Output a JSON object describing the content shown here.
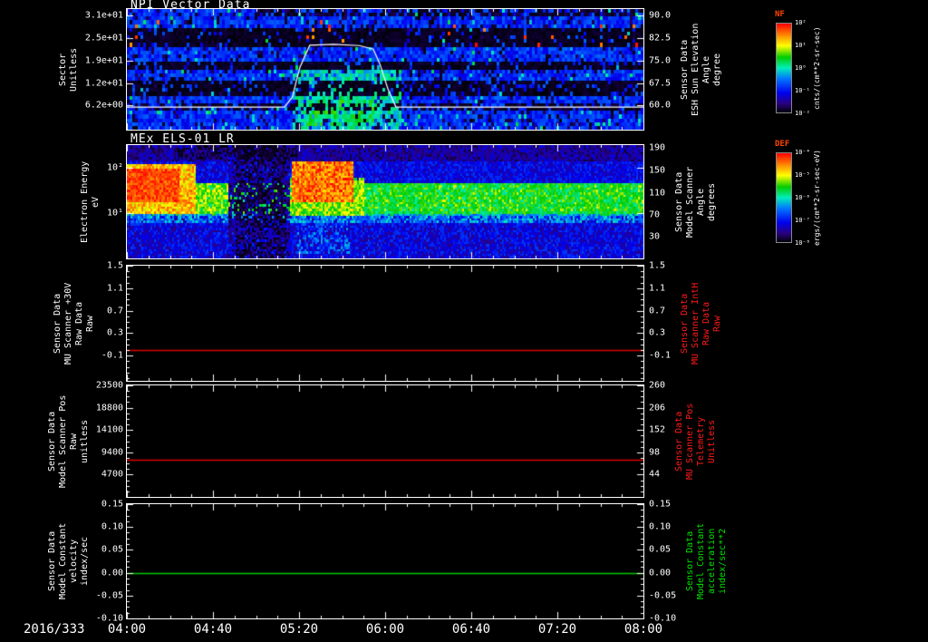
{
  "figure": {
    "background": "#000000",
    "foreground": "#ffffff"
  },
  "colormap": [
    [
      0,
      "#000008"
    ],
    [
      0.1,
      "#2a0080"
    ],
    [
      0.22,
      "#0000ee"
    ],
    [
      0.38,
      "#0077ff"
    ],
    [
      0.5,
      "#00eebb"
    ],
    [
      0.62,
      "#00cc00"
    ],
    [
      0.75,
      "#ffff00"
    ],
    [
      0.87,
      "#ff8800"
    ],
    [
      1,
      "#ff0000"
    ]
  ],
  "xaxis": {
    "date_label": "2016/333",
    "tick_labels": [
      "04:00",
      "04:40",
      "05:20",
      "06:00",
      "06:40",
      "07:20",
      "08:00"
    ]
  },
  "chart_data": [
    {
      "type": "heatmap",
      "title": "NPI Vector Data",
      "ylabel_lines": [
        "Sector",
        "Unitless"
      ],
      "left_ticks": [
        "3.1e+01",
        "2.5e+01",
        "1.9e+01",
        "1.2e+01",
        "6.2e+00"
      ],
      "left_tick_fracs": [
        0.05,
        0.24,
        0.43,
        0.62,
        0.8
      ],
      "right_ticks": [
        "90.0",
        "82.5",
        "75.0",
        "67.5",
        "60.0"
      ],
      "right_tick_fracs": [
        0.05,
        0.24,
        0.43,
        0.62,
        0.8
      ],
      "right_label_lines": [
        "Sensor Data",
        "ESH Sun Elevation",
        "Angle",
        "degree"
      ],
      "right_label_color": "#ffffff",
      "colorbar": {
        "label": "NF",
        "label_color": "#ff4500",
        "units": "cnts/(cm**2-sr-sec)",
        "ticks": [
          "10²",
          "10¹",
          "10⁰",
          "10⁻¹",
          "10⁻²"
        ]
      },
      "x_range": [
        "04:00",
        "08:00"
      ],
      "rows": 32,
      "cols": 190,
      "seed": 7,
      "features": [
        {
          "x": [
            0,
            1
          ],
          "y": [
            0,
            1
          ],
          "v": [
            0.2,
            0.36
          ]
        },
        {
          "x": [
            0.32,
            0.53
          ],
          "y": [
            0.48,
            1
          ],
          "v": [
            0.4,
            0.58
          ],
          "p": 0.85
        },
        {
          "x": [
            0.35,
            0.48
          ],
          "y": [
            0.7,
            0.97
          ],
          "v": [
            0.48,
            0.66
          ],
          "p": 0.6
        },
        {
          "x": [
            0,
            1
          ],
          "y": [
            0,
            1
          ],
          "v": [
            0.0,
            0.08
          ],
          "p": 0.12
        },
        {
          "x": [
            0,
            1
          ],
          "y": [
            0,
            1
          ],
          "v": [
            0.42,
            0.58
          ],
          "p": 0.04
        },
        {
          "x": [
            0,
            1
          ],
          "y": [
            0.16,
            0.3
          ],
          "v": [
            0.0,
            0.04
          ],
          "p": 0.86
        },
        {
          "x": [
            0,
            1
          ],
          "y": [
            0.44,
            0.5
          ],
          "v": [
            0.0,
            0.04
          ],
          "p": 0.82
        },
        {
          "x": [
            0,
            1
          ],
          "y": [
            0.58,
            0.72
          ],
          "v": [
            0.0,
            0.04
          ],
          "p": 0.76
        },
        {
          "x": [
            0,
            1
          ],
          "y": [
            0.79,
            0.83
          ],
          "v": [
            0.0,
            0.04
          ],
          "p": 0.5
        },
        {
          "x": [
            0.25,
            1
          ],
          "y": [
            0,
            0.05
          ],
          "v": [
            0.0,
            0.06
          ],
          "p": 0.55
        },
        {
          "x": [
            0,
            1
          ],
          "y": [
            0.1,
            0.3
          ],
          "v": [
            0.85,
            1.0
          ],
          "p": 0.02
        }
      ],
      "overlay_line": {
        "name": "sun-elevation-angle",
        "color": "#ffffff",
        "value_range": [
          52.3,
          92.3
        ],
        "points": [
          [
            0,
            59.8
          ],
          [
            0.305,
            59.8
          ],
          [
            0.32,
            63
          ],
          [
            0.335,
            73
          ],
          [
            0.354,
            80.3
          ],
          [
            0.4,
            80.6
          ],
          [
            0.45,
            80.2
          ],
          [
            0.477,
            79
          ],
          [
            0.49,
            74
          ],
          [
            0.505,
            66
          ],
          [
            0.521,
            59.8
          ],
          [
            1,
            59.8
          ]
        ]
      }
    },
    {
      "type": "heatmap",
      "title": "MEx ELS-01 LR",
      "ylabel_lines": [
        "Electron Energy",
        "eV"
      ],
      "left_ticks": [
        "10²",
        "10¹"
      ],
      "left_tick_fracs": [
        0.2,
        0.6
      ],
      "right_ticks": [
        "190",
        "150",
        "110",
        "70",
        "30"
      ],
      "right_tick_fracs": [
        0.025,
        0.22,
        0.42,
        0.615,
        0.81
      ],
      "right_label_lines": [
        "Sensor Data",
        "Model Scanner",
        "Angle",
        "degrees"
      ],
      "right_label_color": "#ffffff",
      "colorbar": {
        "label": "DEF",
        "label_color": "#ff4500",
        "units": "ergs/(cm**2-sr-sec-eV)",
        "ticks": [
          "10⁻⁴",
          "10⁻⁵",
          "10⁻⁶",
          "10⁻⁷",
          "10⁻⁸"
        ]
      },
      "x_range": [
        "04:00",
        "08:00"
      ],
      "rows": 48,
      "cols": 285,
      "seed": 13,
      "features": [
        {
          "x": [
            0,
            1
          ],
          "y": [
            0,
            1
          ],
          "v": [
            0.13,
            0.3
          ]
        },
        {
          "x": [
            0,
            1
          ],
          "y": [
            0.7,
            1
          ],
          "v": [
            0.1,
            0.3
          ],
          "p": 0.9
        },
        {
          "x": [
            0,
            1
          ],
          "y": [
            0,
            0.14
          ],
          "v": [
            0.04,
            0.22
          ]
        },
        {
          "x": [
            0,
            1
          ],
          "y": [
            0.34,
            0.62
          ],
          "v": [
            0.5,
            0.68
          ]
        },
        {
          "x": [
            0,
            1
          ],
          "y": [
            0.6,
            0.68
          ],
          "v": [
            0.3,
            0.5
          ],
          "p": 0.7
        },
        {
          "x": [
            0,
            0.135
          ],
          "y": [
            0.16,
            0.6
          ],
          "v": [
            0.7,
            0.92
          ]
        },
        {
          "x": [
            0,
            0.1
          ],
          "y": [
            0.2,
            0.5
          ],
          "v": [
            0.86,
            1.0
          ]
        },
        {
          "x": [
            0.135,
            0.2
          ],
          "y": [
            0.34,
            0.6
          ],
          "v": [
            0.58,
            0.78
          ],
          "p": 0.8
        },
        {
          "x": [
            0.195,
            0.315
          ],
          "y": [
            0,
            1
          ],
          "v": [
            0.02,
            0.22
          ],
          "p": 0.75
        },
        {
          "x": [
            0.21,
            0.31
          ],
          "y": [
            0,
            1
          ],
          "v": [
            0.0,
            0.04
          ],
          "p": 0.35
        },
        {
          "x": [
            0.315,
            0.46
          ],
          "y": [
            0.3,
            0.62
          ],
          "v": [
            0.58,
            0.8
          ],
          "p": 0.9
        },
        {
          "x": [
            0.32,
            0.44
          ],
          "y": [
            0.14,
            0.5
          ],
          "v": [
            0.78,
            1.0
          ]
        },
        {
          "x": [
            0.1,
            0.33
          ],
          "y": [
            0,
            0.12
          ],
          "v": [
            0.0,
            0.05
          ],
          "p": 0.5
        },
        {
          "x": [
            0.45,
            1
          ],
          "y": [
            0.36,
            0.58
          ],
          "v": [
            0.56,
            0.74
          ],
          "p": 0.35
        },
        {
          "x": [
            0.33,
            0.43
          ],
          "y": [
            0.62,
            0.95
          ],
          "v": [
            0.28,
            0.45
          ],
          "p": 0.4
        }
      ]
    },
    {
      "type": "line",
      "ylabel_lines": [
        "Sensor Data",
        "MU Scanner +30V",
        "Raw Data",
        "Raw"
      ],
      "left_ticks": [
        "1.5",
        "1.1",
        "0.7",
        "0.3",
        "-0.1"
      ],
      "tick_values": [
        1.5,
        1.1,
        0.7,
        0.3,
        -0.1
      ],
      "right_ticks": [
        "1.5",
        "1.1",
        "0.7",
        "0.3",
        "-0.1"
      ],
      "right_label_lines": [
        "Sensor Data",
        "MU Scanner IntH",
        "Raw Data",
        "Raw"
      ],
      "right_label_color": "#ff1a1a",
      "y_range": [
        -0.55,
        1.5
      ],
      "series": [
        {
          "name": "mu-scanner-inth",
          "color": "#dd0000",
          "value": 0.0
        }
      ]
    },
    {
      "type": "line",
      "ylabel_lines": [
        "Sensor Data",
        "Model Scanner Pos",
        "Raw",
        "unitless"
      ],
      "left_ticks": [
        "23500",
        "18800",
        "14100",
        "9400",
        "4700"
      ],
      "tick_values": [
        23500,
        18800,
        14100,
        9400,
        4700
      ],
      "right_ticks": [
        "260",
        "206",
        "152",
        "98",
        "44"
      ],
      "right_label_lines": [
        "Sensor Data",
        "MU Scanner Pos",
        "Telemetry",
        "Unitless"
      ],
      "right_label_color": "#ff1a1a",
      "y_range": [
        0,
        23500
      ],
      "series": [
        {
          "name": "mu-scanner-pos",
          "color": "#dd0000",
          "value": 7900
        }
      ]
    },
    {
      "type": "line",
      "ylabel_lines": [
        "Sensor Data",
        "Model Constant",
        "velocity",
        "index/sec"
      ],
      "left_ticks": [
        "0.15",
        "0.10",
        "0.05",
        "0.00",
        "-0.05",
        "-0.10"
      ],
      "tick_values": [
        0.15,
        0.1,
        0.05,
        0.0,
        -0.05,
        -0.1
      ],
      "right_ticks": [
        "0.15",
        "0.10",
        "0.05",
        "0.00",
        "-0.05",
        "-0.10"
      ],
      "right_label_lines": [
        "Sensor Data",
        "Model Constant",
        "acceleration",
        "index/sec**2"
      ],
      "right_label_color": "#00e000",
      "y_range": [
        -0.1,
        0.15
      ],
      "series": [
        {
          "name": "model-constant-acceleration",
          "color": "#00cc00",
          "value": 0.0
        }
      ]
    }
  ]
}
